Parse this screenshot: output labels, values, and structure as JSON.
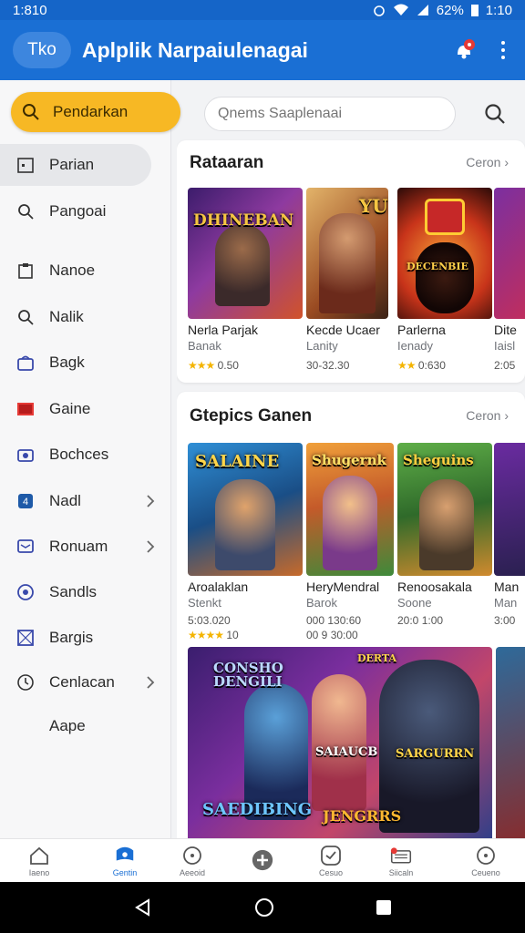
{
  "status_bar": {
    "time_left": "1:810",
    "battery": "62%",
    "time_right": "1:10"
  },
  "app_bar": {
    "logo_text": "Tko",
    "title": "Aplplik Narpaiulenagai"
  },
  "sidebar": {
    "primary_button": "Pendarkan",
    "items": [
      {
        "label": "Parian",
        "icon": "calendar-icon"
      },
      {
        "label": "Pangoai",
        "icon": "search-icon"
      },
      {
        "label": "Nanoe",
        "icon": "clipboard-icon"
      },
      {
        "label": "Nalik",
        "icon": "search-icon"
      },
      {
        "label": "Bagk",
        "icon": "bag-icon"
      },
      {
        "label": "Gaine",
        "icon": "game-icon"
      },
      {
        "label": "Bochces",
        "icon": "camera-icon"
      },
      {
        "label": "Nadl",
        "icon": "number-badge-icon",
        "badge": "4"
      },
      {
        "label": "Ronuam",
        "icon": "message-icon"
      },
      {
        "label": "Sandls",
        "icon": "disc-icon"
      },
      {
        "label": "Bargis",
        "icon": "image-icon"
      },
      {
        "label": "Cenlacan",
        "icon": "clock-icon"
      },
      {
        "label": "Aape",
        "icon": ""
      }
    ]
  },
  "search": {
    "placeholder": "Qnems Saaplenaai"
  },
  "section1": {
    "title": "Rataaran",
    "more": "Ceron",
    "tiles": [
      {
        "art": "DHINEBAN",
        "title": "Nerla Parjak",
        "sub": "Banak",
        "stars": "★★★",
        "meta": "0.50",
        "colors": [
          "#5a2d8c",
          "#d14b2a"
        ]
      },
      {
        "art": "YUE",
        "title": "Kecde Ucaer",
        "sub": "Lanity",
        "stars": "",
        "meta": "30-32.30",
        "colors": [
          "#d9a14a",
          "#8a3b1d"
        ]
      },
      {
        "art": "DECENBIE",
        "title": "Parlerna",
        "sub": "Ienady",
        "stars": "★★",
        "meta": "0:630",
        "colors": [
          "#e0671c",
          "#5c120d"
        ]
      },
      {
        "art": "",
        "title": "Dite",
        "sub": "Iaisl",
        "stars": "",
        "meta": "2:05",
        "colors": [
          "#7b2fa0",
          "#c22e5c"
        ]
      }
    ]
  },
  "section2": {
    "title": "Gtepics Ganen",
    "more": "Ceron",
    "tiles": [
      {
        "art": "SALAINE",
        "title": "Aroalaklan",
        "sub": "Stenkt",
        "stars": "★★★★",
        "meta": "5:03.020",
        "meta2": "10",
        "colors": [
          "#1d6fb0",
          "#d67a2c"
        ]
      },
      {
        "art": "Shugernk",
        "title": "HeryMendral",
        "sub": "Barok",
        "stars": "",
        "meta": "000 130:60",
        "meta2": "00 9 30:00",
        "colors": [
          "#e07b2b",
          "#4b8d3c"
        ]
      },
      {
        "art": "Sheguins",
        "title": "Renoosakala",
        "sub": "Soone",
        "stars": "",
        "meta": "20:0 1:00",
        "meta2": "",
        "colors": [
          "#4f9b3b",
          "#d48a32"
        ]
      },
      {
        "art": "",
        "title": "Man",
        "sub": "Man",
        "stars": "",
        "meta": "3:00",
        "meta2": "",
        "colors": [
          "#6a2ba0",
          "#2a2050"
        ]
      }
    ],
    "banner": {
      "art_top": "CONSHO DENGILI",
      "art_mid": "SAIAUCB",
      "art_mid2": "SARGURRN",
      "art_bottom_left": "SAEDIBING",
      "art_bottom_mid": "JENGRRS",
      "badge": "DERTA"
    }
  },
  "bottom_nav": [
    {
      "label": "Iaeno",
      "icon": "home-icon",
      "active": false
    },
    {
      "label": "Gentin",
      "icon": "gamepad-icon",
      "active": true
    },
    {
      "label": "Aeeoid",
      "icon": "circle-icon",
      "active": false
    },
    {
      "label": "",
      "icon": "plus-icon",
      "active": false
    },
    {
      "label": "Cesuo",
      "icon": "check-circle-icon",
      "active": false
    },
    {
      "label": "Siicaln",
      "icon": "keyboard-icon",
      "active": false
    },
    {
      "label": "Ceueno",
      "icon": "clock-icon",
      "active": false
    }
  ]
}
